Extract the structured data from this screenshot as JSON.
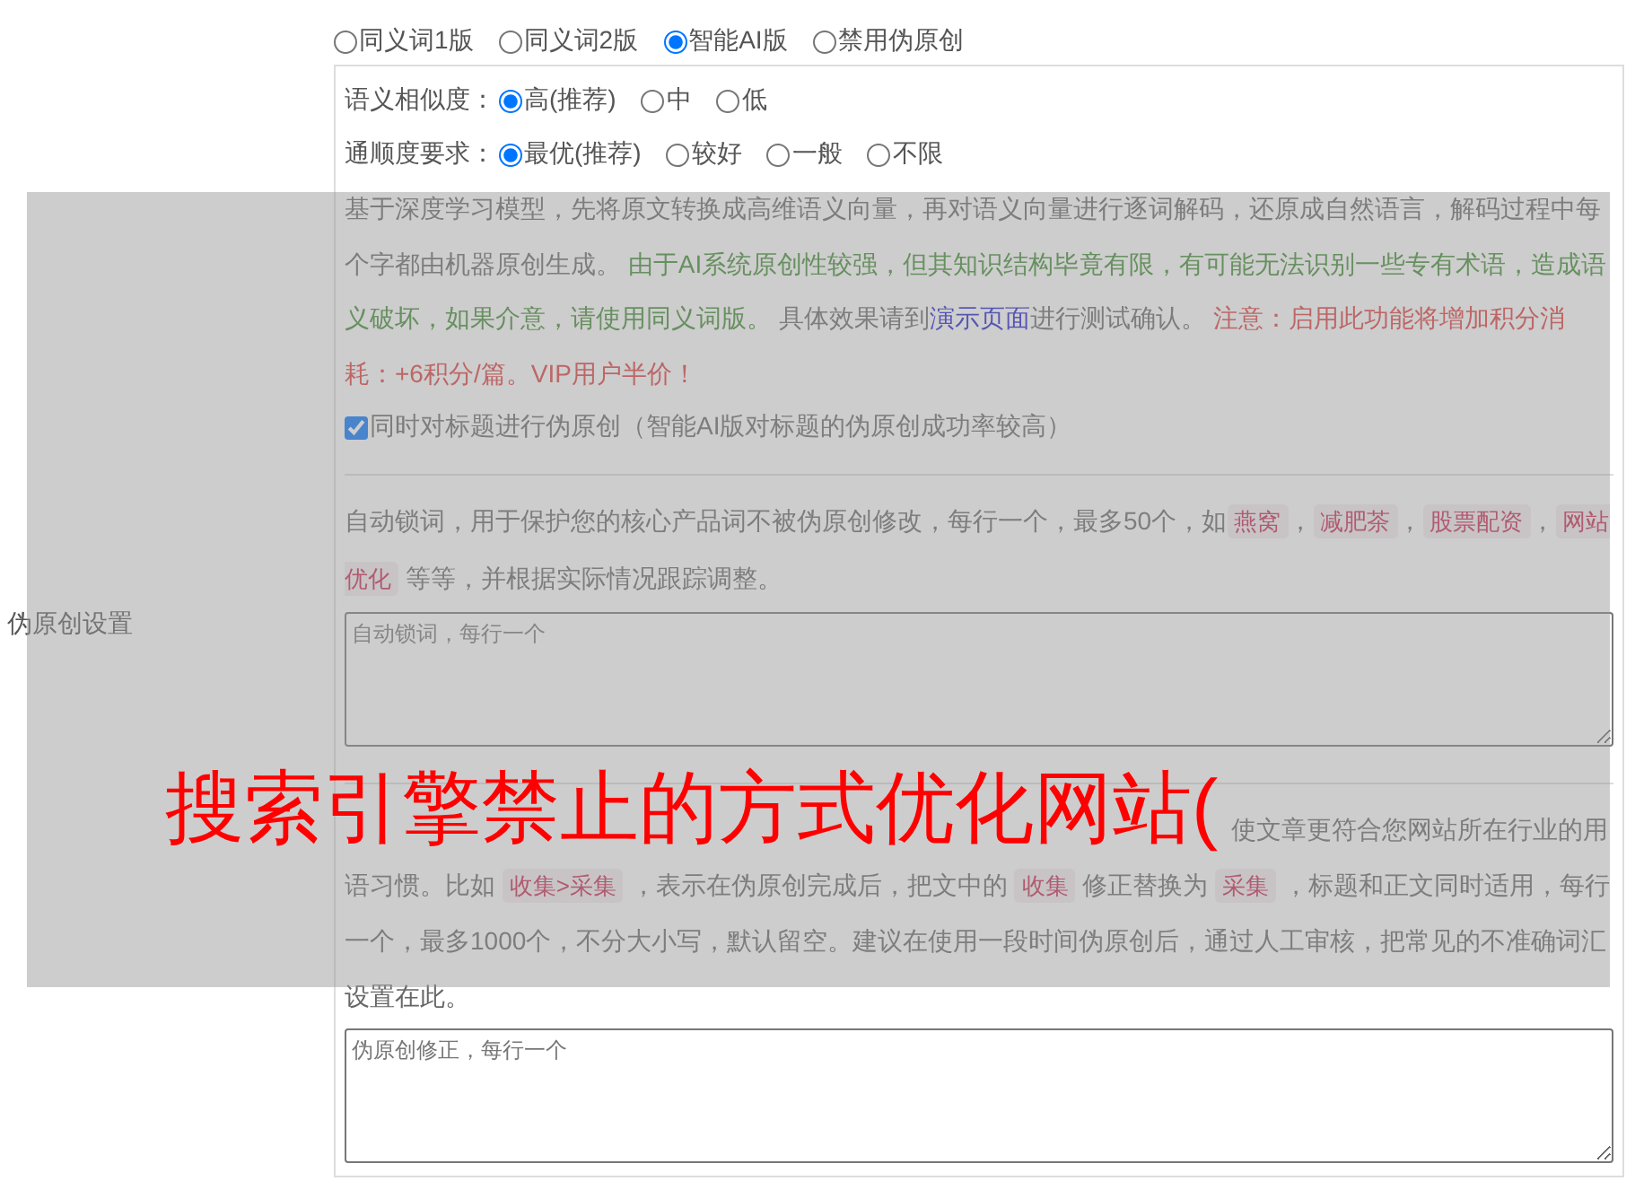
{
  "modes": [
    {
      "label": "同义词1版",
      "selected": false
    },
    {
      "label": "同义词2版",
      "selected": false
    },
    {
      "label": "智能AI版",
      "selected": true
    },
    {
      "label": "禁用伪原创",
      "selected": false
    }
  ],
  "section_label": "伪原创设置",
  "options": [
    {
      "label": "语义相似度：",
      "choices": [
        {
          "label": "高(推荐)",
          "selected": true
        },
        {
          "label": "中",
          "selected": false
        },
        {
          "label": "低",
          "selected": false
        }
      ]
    },
    {
      "label": "通顺度要求：",
      "choices": [
        {
          "label": "最优(推荐)",
          "selected": true
        },
        {
          "label": "较好",
          "selected": false
        },
        {
          "label": "一般",
          "selected": false
        },
        {
          "label": "不限",
          "selected": false
        }
      ]
    }
  ],
  "description": [
    {
      "kind": "plain",
      "text": "基于深度学习模型，先将原文转换成高维语义向量，再对语义向量进行逐词解码，还原成自然语言，解码过程中每个字都由机器原创生成。 "
    },
    {
      "kind": "green",
      "text": "由于AI系统原创性较强，但其知识结构毕竟有限，有可能无法识别一些专有术语，造成语义破坏，如果介意，请使用同义词版。"
    },
    {
      "kind": "plain",
      "text": " 具体效果请到"
    },
    {
      "kind": "link",
      "text": "演示页面"
    },
    {
      "kind": "plain",
      "text": "进行测试确认。 "
    },
    {
      "kind": "red",
      "text": "注意：启用此功能将增加积分消耗：+6积分/篇。VIP用户半价！"
    }
  ],
  "title_checkbox": {
    "label": "同时对标题进行伪原创（智能AI版对标题的伪原创成功率较高）",
    "checked": true
  },
  "lock_words": {
    "description": [
      {
        "kind": "plain",
        "text": "自动锁词，用于保护您的核心产品词不被伪原创修改，每行一个，最多50个，如"
      },
      {
        "kind": "code",
        "text": "燕窝"
      },
      {
        "kind": "plain",
        "text": "，"
      },
      {
        "kind": "code",
        "text": "减肥茶"
      },
      {
        "kind": "plain",
        "text": "，"
      },
      {
        "kind": "code",
        "text": "股票配资"
      },
      {
        "kind": "plain",
        "text": "，"
      },
      {
        "kind": "code",
        "text": "网站优化"
      },
      {
        "kind": "plain",
        "text": " 等等，并根据实际情况跟踪调整。"
      }
    ],
    "placeholder": "自动锁词，每行一个"
  },
  "corrections": {
    "description": [
      {
        "kind": "plain",
        "text": "使文章更符合您网站所在行业的用语习惯。比如 "
      },
      {
        "kind": "code",
        "text": "收集>采集"
      },
      {
        "kind": "plain",
        "text": " ，表示在伪原创完成后，把文中的 "
      },
      {
        "kind": "code",
        "text": "收集"
      },
      {
        "kind": "plain",
        "text": " 修正替换为 "
      },
      {
        "kind": "code",
        "text": "采集"
      },
      {
        "kind": "plain",
        "text": " ，标题和正文同时适用，每行一个，最多1000个，不分大小写，默认留空。建议在使用一段时间伪原创后，通过人工审核，把常见的不准确词汇设置在此。"
      }
    ],
    "placeholder": "伪原创修正，每行一个"
  },
  "overlay": {
    "title": "搜索引擎禁止的方式优化网站("
  }
}
